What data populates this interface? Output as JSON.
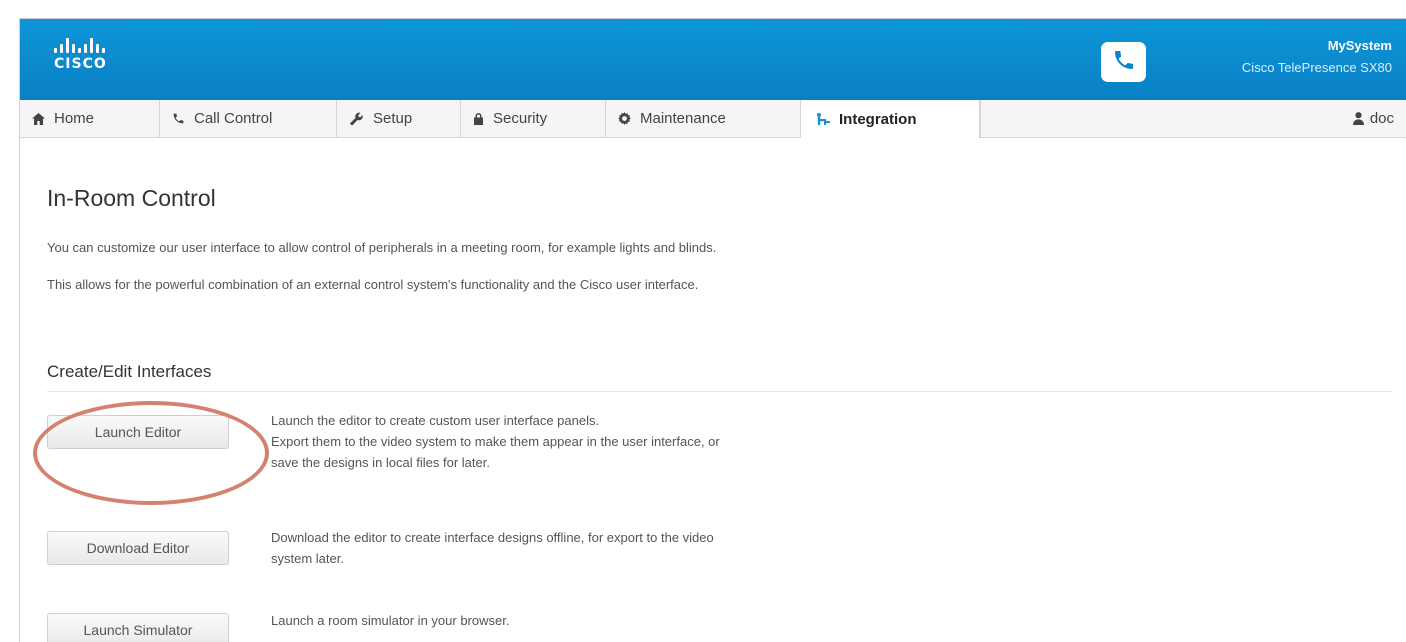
{
  "header": {
    "logo_text": "CISCO",
    "system_name": "MySystem",
    "system_model": "Cisco TelePresence SX80",
    "call_icon": "phone-icon"
  },
  "nav": {
    "tabs": [
      {
        "label": "Home",
        "icon": "home-icon"
      },
      {
        "label": "Call Control",
        "icon": "phone-icon"
      },
      {
        "label": "Setup",
        "icon": "wrench-icon"
      },
      {
        "label": "Security",
        "icon": "lock-icon"
      },
      {
        "label": "Maintenance",
        "icon": "gear-icon"
      },
      {
        "label": "Integration",
        "icon": "integration-icon",
        "active": true
      }
    ],
    "user": {
      "label": "doc",
      "icon": "user-icon"
    }
  },
  "main": {
    "title": "In-Room Control",
    "descriptions": [
      "You can customize our user interface to allow control of peripherals in a meeting room, for example lights and blinds.",
      "This allows for the powerful combination of an external control system's functionality and the Cisco user interface."
    ],
    "section_title": "Create/Edit Interfaces",
    "actions": [
      {
        "button": "Launch Editor",
        "lines": [
          "Launch the editor to create custom user interface panels.",
          "Export them to the video system to make them appear in the user interface, or",
          "save the designs in local files for later."
        ]
      },
      {
        "button": "Download Editor",
        "lines": [
          "Download the editor to create interface designs offline, for export to the video",
          "system later."
        ]
      },
      {
        "button": "Launch Simulator",
        "lines": [
          "Launch a room simulator in your browser."
        ]
      }
    ]
  },
  "colors": {
    "header": "#0a8bd0",
    "highlight_ring": "#d4816f",
    "active_icon": "#1a8fd6"
  }
}
